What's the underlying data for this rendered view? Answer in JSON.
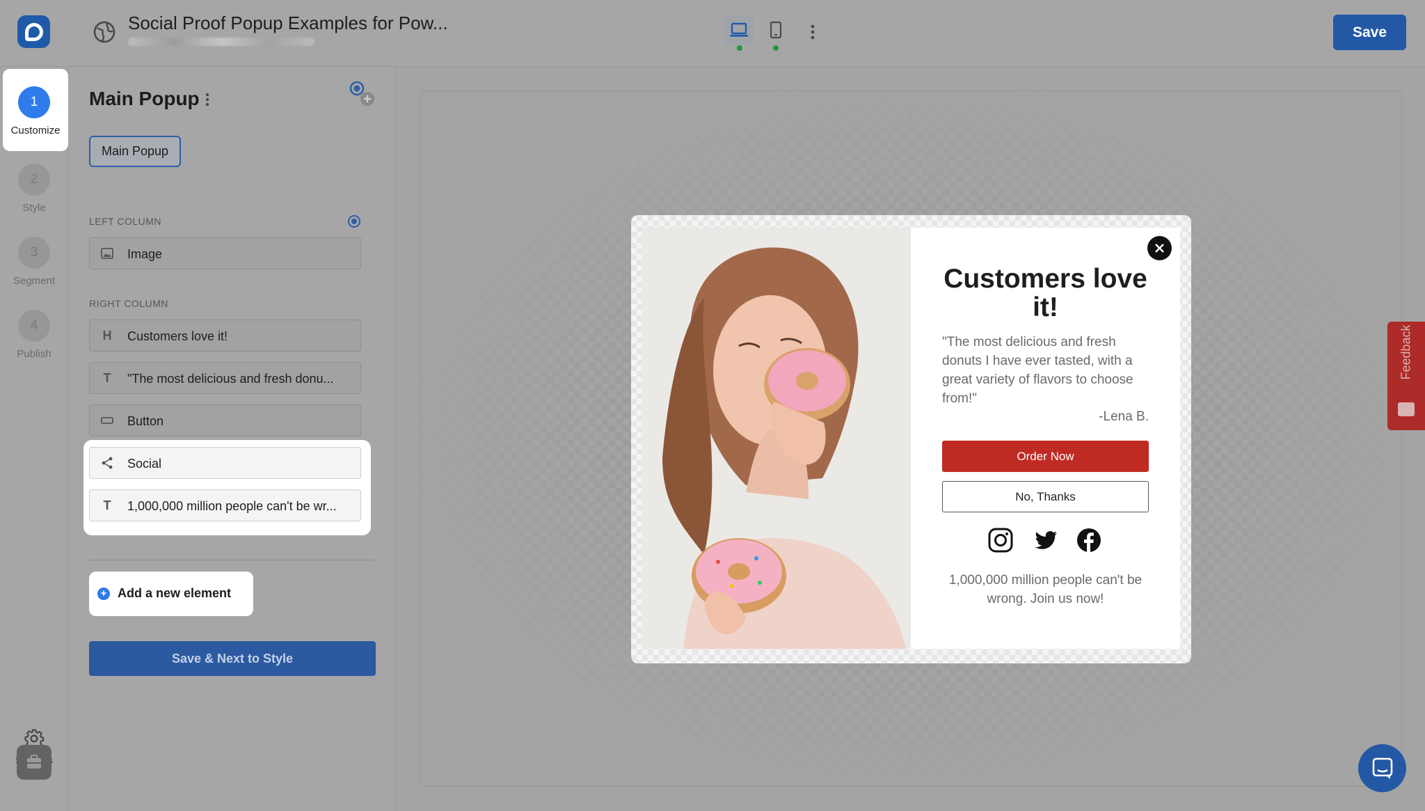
{
  "header": {
    "title": "Social Proof Popup Examples for Pow...",
    "save_label": "Save"
  },
  "steps": [
    {
      "number": "1",
      "label": "Customize"
    },
    {
      "number": "2",
      "label": "Style"
    },
    {
      "number": "3",
      "label": "Segment"
    },
    {
      "number": "4",
      "label": "Publish"
    }
  ],
  "rail": {
    "settings_label": "Settings"
  },
  "panel": {
    "title": "Main Popup",
    "tab_label": "Main Popup",
    "left_column_label": "LEFT COLUMN",
    "right_column_label": "RIGHT COLUMN",
    "left_elements": [
      {
        "icon": "image-icon",
        "label": "Image"
      }
    ],
    "right_elements": [
      {
        "icon": "heading-icon",
        "glyph": "H",
        "label": "Customers love it!"
      },
      {
        "icon": "text-icon",
        "glyph": "T",
        "label": "\"The most delicious and fresh donu..."
      },
      {
        "icon": "button-icon",
        "label": "Button"
      },
      {
        "icon": "share-icon",
        "label": "Social"
      },
      {
        "icon": "text-icon",
        "glyph": "T",
        "label": "1,000,000 million people can't be wr..."
      }
    ],
    "add_label": "Add a new element",
    "next_label": "Save & Next to Style"
  },
  "popup": {
    "heading": "Customers love it!",
    "quote": "\"The most delicious and fresh donuts I have ever tasted, with a great variety of flavors to choose from!\"",
    "author": "-Lena B.",
    "primary_button": "Order Now",
    "secondary_button": "No, Thanks",
    "social_icons": [
      "instagram-icon",
      "twitter-icon",
      "facebook-icon"
    ],
    "footer": "1,000,000 million people can't be wrong. Join us now!"
  },
  "feedback_label": "Feedback",
  "colors": {
    "accent": "#2358a5",
    "step_active": "#2f7bec",
    "order_button": "#bf2b23",
    "feedback_tab": "#ad2b28"
  }
}
